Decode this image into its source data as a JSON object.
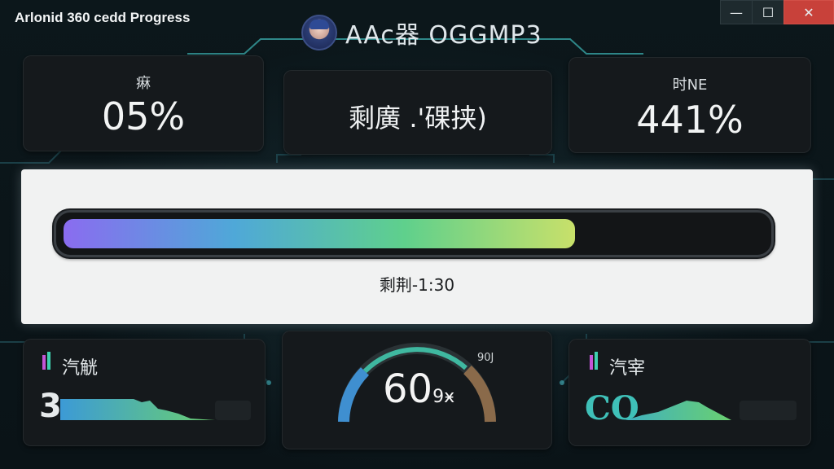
{
  "window": {
    "title": "Arlonid 360 cedd Progress",
    "minimize_glyph": "—",
    "maximize_glyph": "☐",
    "close_glyph": "✕"
  },
  "brand": {
    "text": "AAc器 OGGMP3",
    "avatar_icon": "anime-avatar-icon"
  },
  "stats": {
    "left_label": "痳",
    "left_value": "05%",
    "center_text": "剩廣 .'䂺挟)",
    "right_label": "时NE",
    "right_value": "441%"
  },
  "progress": {
    "percent": 73,
    "remaining_text": "剩荆-1:30",
    "gradient_colors": [
      "#8a6cf0",
      "#4fa8d8",
      "#5fd08c",
      "#c8e06a"
    ]
  },
  "bottom": {
    "left_title": "汽觥",
    "left_value": "3",
    "gauge_value": "60",
    "gauge_unit": "9ӿ",
    "gauge_small": "90J",
    "right_title": "汽宰",
    "right_value": "CO"
  },
  "colors": {
    "accent_teal": "#3fb8b8",
    "close_red": "#c8413a"
  }
}
